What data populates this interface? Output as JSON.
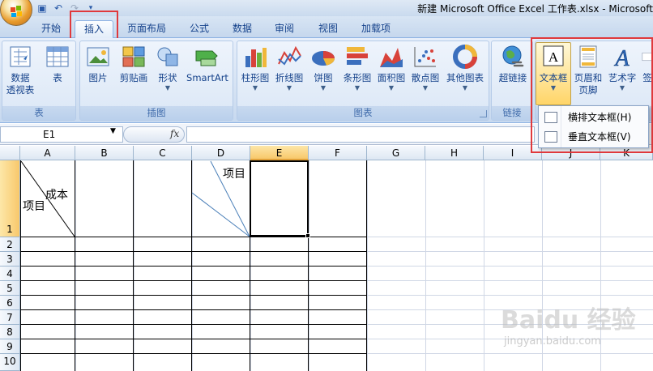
{
  "window": {
    "title": "新建 Microsoft Office Excel 工作表.xlsx - Microsoft"
  },
  "tabs": [
    {
      "label": "开始"
    },
    {
      "label": "插入"
    },
    {
      "label": "页面布局"
    },
    {
      "label": "公式"
    },
    {
      "label": "数据"
    },
    {
      "label": "审阅"
    },
    {
      "label": "视图"
    },
    {
      "label": "加载项"
    }
  ],
  "ribbon": {
    "groups": {
      "table": {
        "label": "表",
        "pivot_line1": "数据",
        "pivot_line2": "透视表",
        "table": "表"
      },
      "illustrations": {
        "label": "插图",
        "picture": "图片",
        "clipart": "剪贴画",
        "shapes": "形状",
        "smartart": "SmartArt"
      },
      "charts": {
        "label": "图表",
        "column": "柱形图",
        "line": "折线图",
        "pie": "饼图",
        "bar": "条形图",
        "area": "面积图",
        "scatter": "散点图",
        "other": "其他图表"
      },
      "links": {
        "label": "链接",
        "hyperlink": "超链接"
      },
      "text": {
        "textbox": "文本框",
        "header_line1": "页眉和",
        "header_line2": "页脚",
        "wordart": "艺术字",
        "signature_partial": "签"
      }
    }
  },
  "dropdown": {
    "items": [
      {
        "label": "横排文本框(H)"
      },
      {
        "label": "垂直文本框(V)"
      }
    ]
  },
  "formula_bar": {
    "name_box": "E1",
    "fx": "fx",
    "formula": ""
  },
  "sheet": {
    "columns": [
      "A",
      "B",
      "C",
      "D",
      "E",
      "F",
      "G",
      "H",
      "I",
      "J",
      "K"
    ],
    "rows": [
      "1",
      "2",
      "3",
      "4",
      "5",
      "6",
      "7",
      "8",
      "9",
      "10"
    ],
    "selected_cell": "E1",
    "cells": {
      "a1_top": "成本",
      "a1_bottom": "项目",
      "d1_top": "项目"
    }
  },
  "watermark": {
    "text": "Baidu 经验",
    "sub": "jingyan.baidu.com"
  },
  "colors": {
    "highlight_red": "#e0393c",
    "ribbon_text": "#15428b",
    "selected_header": "#f8c86b"
  }
}
